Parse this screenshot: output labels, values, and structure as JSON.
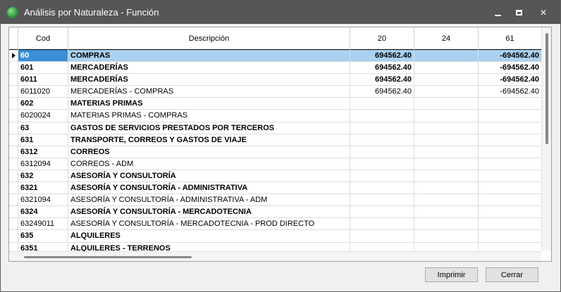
{
  "window": {
    "title": "Análisis por Naturaleza - Función",
    "minimize_glyph": "",
    "close_glyph": "✕"
  },
  "grid": {
    "columns": {
      "cod": "Cod",
      "desc": "Descripción",
      "c20": "20",
      "c24": "24",
      "c61": "61"
    },
    "rows": [
      {
        "cod": "60",
        "desc": "COMPRAS",
        "c20": "694562.40",
        "c24": "",
        "c61": "-694562.40"
      },
      {
        "cod": "601",
        "desc": "MERCADERÍAS",
        "c20": "694562.40",
        "c24": "",
        "c61": "-694562.40"
      },
      {
        "cod": "6011",
        "desc": "MERCADERÍAS",
        "c20": "694562.40",
        "c24": "",
        "c61": "-694562.40"
      },
      {
        "cod": "6011020",
        "desc": "MERCADERÍAS - COMPRAS",
        "c20": "694562.40",
        "c24": "",
        "c61": "-694562.40"
      },
      {
        "cod": "602",
        "desc": "MATERIAS PRIMAS",
        "c20": "",
        "c24": "",
        "c61": ""
      },
      {
        "cod": "6020024",
        "desc": "MATERIAS PRIMAS - COMPRAS",
        "c20": "",
        "c24": "",
        "c61": ""
      },
      {
        "cod": "63",
        "desc": "GASTOS DE SERVICIOS PRESTADOS POR TERCEROS",
        "c20": "",
        "c24": "",
        "c61": ""
      },
      {
        "cod": "631",
        "desc": "TRANSPORTE, CORREOS Y GASTOS DE VIAJE",
        "c20": "",
        "c24": "",
        "c61": ""
      },
      {
        "cod": "6312",
        "desc": "CORREOS",
        "c20": "",
        "c24": "",
        "c61": ""
      },
      {
        "cod": "6312094",
        "desc": "CORREOS - ADM",
        "c20": "",
        "c24": "",
        "c61": ""
      },
      {
        "cod": "632",
        "desc": "ASESORÍA Y CONSULTORÍA",
        "c20": "",
        "c24": "",
        "c61": ""
      },
      {
        "cod": "6321",
        "desc": "ASESORÍA Y CONSULTORÍA - ADMINISTRATIVA",
        "c20": "",
        "c24": "",
        "c61": ""
      },
      {
        "cod": "6321094",
        "desc": "ASESORÍA Y CONSULTORÍA - ADMINISTRATIVA - ADM",
        "c20": "",
        "c24": "",
        "c61": ""
      },
      {
        "cod": "6324",
        "desc": "ASESORÍA Y CONSULTORÍA - MERCADOTECNIA",
        "c20": "",
        "c24": "",
        "c61": ""
      },
      {
        "cod": "63249011",
        "desc": "ASESORÍA Y CONSULTORÍA - MERCADOTECNIA - PROD DIRECTO",
        "c20": "",
        "c24": "",
        "c61": ""
      },
      {
        "cod": "635",
        "desc": "ALQUILERES",
        "c20": "",
        "c24": "",
        "c61": ""
      },
      {
        "cod": "6351",
        "desc": "ALQUILERES - TERRENOS",
        "c20": "",
        "c24": "",
        "c61": ""
      }
    ]
  },
  "buttons": {
    "print": "Imprimir",
    "close": "Cerrar"
  },
  "colors": {
    "titlebar": "#565656",
    "selection": "#aad1f0",
    "selection_cell": "#3b8fd8"
  }
}
